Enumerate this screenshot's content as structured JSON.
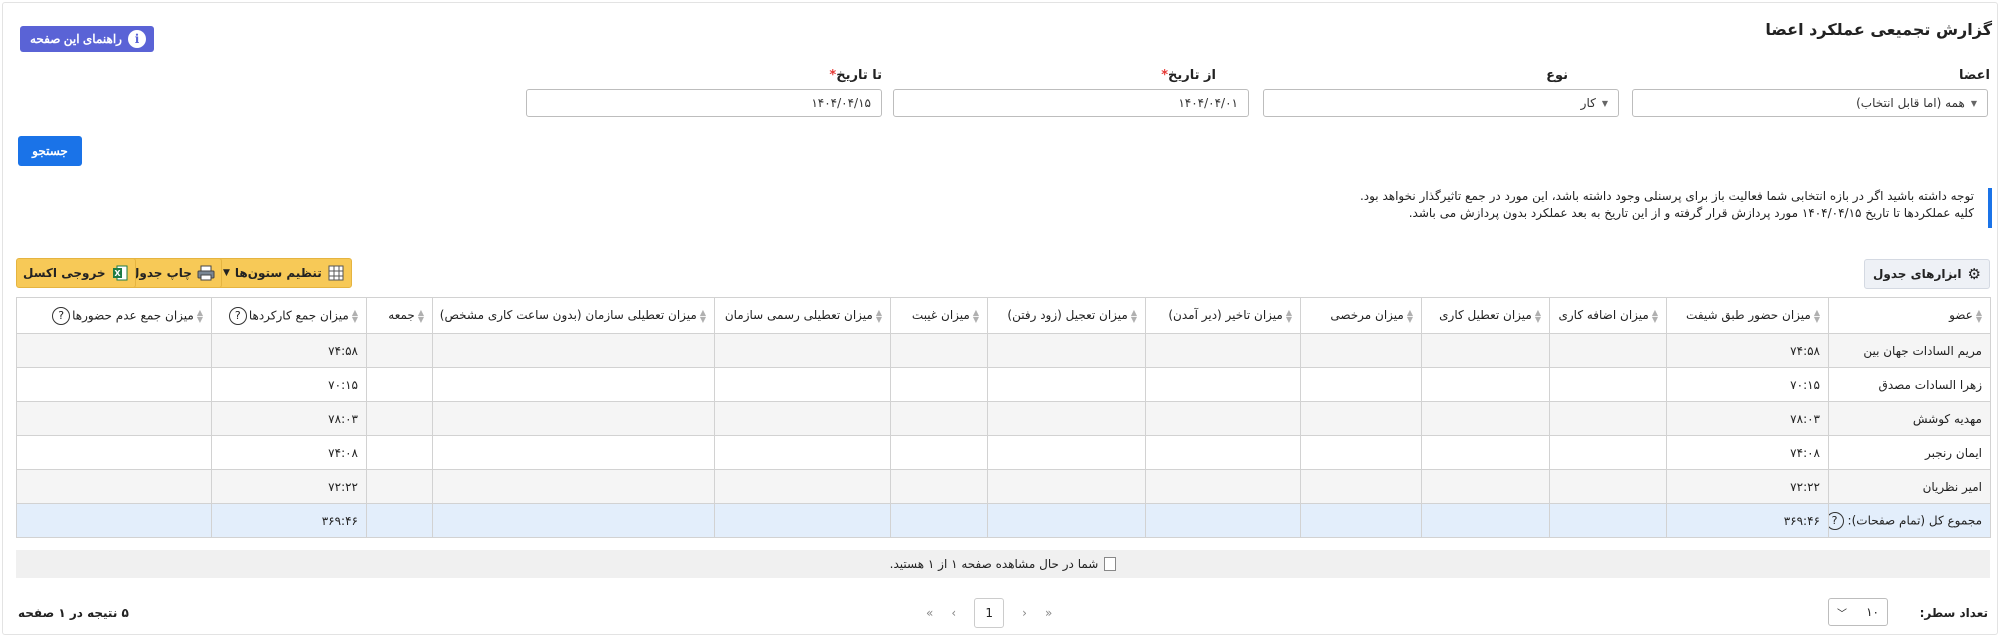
{
  "page": {
    "title": "گزارش تجمیعی عملکرد اعضا",
    "help_label": "راهنمای این صفحه"
  },
  "filters": {
    "members_label": "اعضا",
    "members_value": "همه (اما قابل انتخاب)",
    "type_label": "نوع",
    "type_value": "کار",
    "from_label": "از تاریخ",
    "from_value": "۱۴۰۴/۰۴/۰۱",
    "to_label": "تا تاریخ",
    "to_value": "۱۴۰۴/۰۴/۱۵",
    "required_mark": "*",
    "search_label": "جستجو"
  },
  "notice": {
    "line1": "توجه داشته باشید اگر در بازه انتخابی شما فعالیت باز برای پرسنلی وجود داشته باشد، این مورد در جمع تاثیرگذار نخواهد بود.",
    "line2": "کلیه عملکردها تا تاریخ ۱۴۰۴/۰۴/۱۵ مورد پردازش قرار گرفته و از این تاریخ به بعد عملکرد بدون پردازش می باشد."
  },
  "toolbar": {
    "tools_label": "ابزارهای جدول",
    "columns_label": "تنظیم ستون‌ها",
    "print_label": "چاپ جدول",
    "excel_label": "خروجی اکسل"
  },
  "table": {
    "columns": [
      "عضو",
      "میزان حضور طبق شیفت",
      "میزان اضافه کاری",
      "میزان تعطیل کاری",
      "میزان مرخصی",
      "میزان تاخیر (دیر آمدن)",
      "میزان تعجیل (زود رفتن)",
      "میزان غیبت",
      "میزان تعطیلی رسمی سازمان",
      "میزان تعطیلی سازمان (بدون ساعت کاری مشخص)",
      "جمعه",
      "میزان جمع کارکردها",
      "میزان جمع عدم حضورها"
    ],
    "help_mark": "?",
    "rows": [
      [
        "مریم السادات جهان بین",
        "۷۴:۵۸",
        "",
        "",
        "",
        "",
        "",
        "",
        "",
        "",
        "",
        "۷۴:۵۸",
        ""
      ],
      [
        "زهرا السادات مصدق",
        "۷۰:۱۵",
        "",
        "",
        "",
        "",
        "",
        "",
        "",
        "",
        "",
        "۷۰:۱۵",
        ""
      ],
      [
        "مهدیه کوشش",
        "۷۸:۰۳",
        "",
        "",
        "",
        "",
        "",
        "",
        "",
        "",
        "",
        "۷۸:۰۳",
        ""
      ],
      [
        "ایمان رنجبر",
        "۷۴:۰۸",
        "",
        "",
        "",
        "",
        "",
        "",
        "",
        "",
        "",
        "۷۴:۰۸",
        ""
      ],
      [
        "امیر نظریان",
        "۷۲:۲۲",
        "",
        "",
        "",
        "",
        "",
        "",
        "",
        "",
        "",
        "۷۲:۲۲",
        ""
      ]
    ],
    "total_label": "مجموع کل (تمام صفحات):",
    "total_values": [
      "۳۶۹:۴۶",
      "",
      "",
      "",
      "",
      "",
      "",
      "",
      "",
      "",
      "۳۶۹:۴۶",
      ""
    ]
  },
  "pagination": {
    "status_text": "شما در حال مشاهده صفحه ۱ از ۱ هستید.",
    "first": "«",
    "prev": "‹",
    "current_page": "1",
    "next": "›",
    "last": "»",
    "rows_label": "تعداد سطر:",
    "rows_value": "۱۰",
    "result_text": "۵ نتیجه در ۱ صفحه"
  }
}
